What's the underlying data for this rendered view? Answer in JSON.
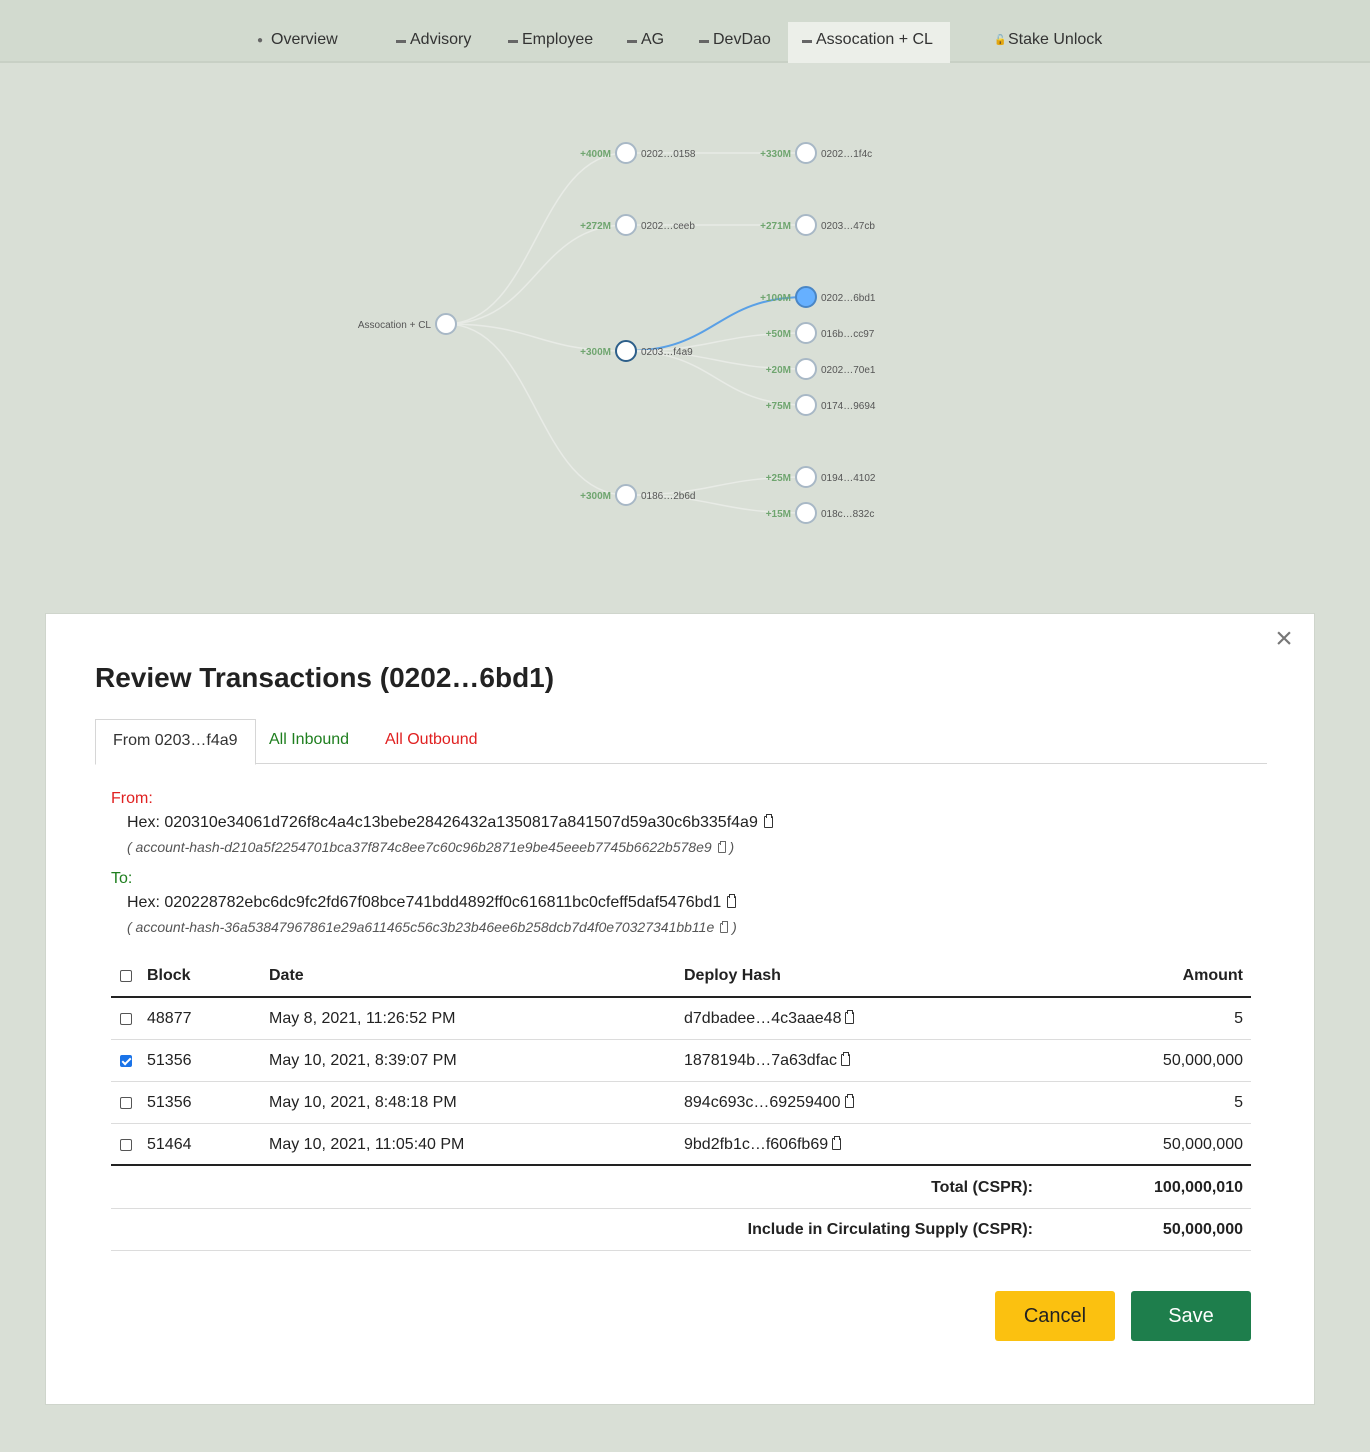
{
  "nav": {
    "tabs": [
      {
        "label": "Overview",
        "icon": "globe-icon"
      },
      {
        "label": "Advisory",
        "icon": "folder-icon"
      },
      {
        "label": "Employee",
        "icon": "folder-icon"
      },
      {
        "label": "AG",
        "icon": "folder-icon"
      },
      {
        "label": "DevDao",
        "icon": "folder-icon"
      },
      {
        "label": "Assocation + CL",
        "icon": "folder-icon",
        "active": true
      },
      {
        "label": "Stake Unlock",
        "icon": "unlock-icon"
      }
    ]
  },
  "tree": {
    "root": {
      "label": "Assocation + CL"
    },
    "level1": [
      {
        "amount": "+400M",
        "label": "0202…0158"
      },
      {
        "amount": "+272M",
        "label": "0202…ceeb"
      },
      {
        "amount": "+300M",
        "label": "0203…f4a9"
      },
      {
        "amount": "+300M",
        "label": "0186…2b6d"
      }
    ],
    "level2": [
      {
        "amount": "+330M",
        "label": "0202…1f4c"
      },
      {
        "amount": "+271M",
        "label": "0203…47cb"
      },
      {
        "amount": "+100M",
        "label": "0202…6bd1"
      },
      {
        "amount": "+50M",
        "label": "016b…cc97"
      },
      {
        "amount": "+20M",
        "label": "0202…70e1"
      },
      {
        "amount": "+75M",
        "label": "0174…9694"
      },
      {
        "amount": "+25M",
        "label": "0194…4102"
      },
      {
        "amount": "+15M",
        "label": "018c…832c"
      }
    ],
    "colors": {
      "amount": "#6fa56f",
      "highlight_link": "#5aa0e6",
      "selected_node": "#66b0ff"
    }
  },
  "modal": {
    "title": "Review Transactions (0202…6bd1)",
    "close": "×",
    "tabs": {
      "from": "From 0203…f4a9",
      "inbound": "All Inbound",
      "outbound": "All Outbound"
    },
    "from": {
      "label": "From:",
      "hex": "Hex: 020310e34061d726f8c4a4c13bebe28426432a1350817a841507d59a30c6b335f4a9",
      "account_hash": "( account-hash-d210a5f2254701bca37f874c8ee7c60c96b2871e9be45eeeb7745b6622b578e9",
      "close_paren": ")"
    },
    "to": {
      "label": "To:",
      "hex": "Hex: 020228782ebc6dc9fc2fd67f08bce741bdd4892ff0c616811bc0cfeff5daf5476bd1",
      "account_hash": "( account-hash-36a53847967861e29a611465c56c3b23b46ee6b258dcb7d4f0e70327341bb11e",
      "close_paren": ")"
    },
    "table": {
      "headers": {
        "block": "Block",
        "date": "Date",
        "hash": "Deploy Hash",
        "amount": "Amount"
      },
      "rows": [
        {
          "checked": false,
          "block": "48877",
          "date": "May 8, 2021, 11:26:52 PM",
          "hash": "d7dbadee…4c3aae48",
          "amount": "5"
        },
        {
          "checked": true,
          "block": "51356",
          "date": "May 10, 2021, 8:39:07 PM",
          "hash": "1878194b…7a63dfac",
          "amount": "50,000,000"
        },
        {
          "checked": false,
          "block": "51356",
          "date": "May 10, 2021, 8:48:18 PM",
          "hash": "894c693c…69259400",
          "amount": "5"
        },
        {
          "checked": false,
          "block": "51464",
          "date": "May 10, 2021, 11:05:40 PM",
          "hash": "9bd2fb1c…f606fb69",
          "amount": "50,000,000"
        }
      ],
      "total_label": "Total (CSPR):",
      "total_value": "100,000,010",
      "include_label": "Include in Circulating Supply (CSPR):",
      "include_value": "50,000,000"
    },
    "buttons": {
      "cancel": "Cancel",
      "save": "Save"
    }
  }
}
